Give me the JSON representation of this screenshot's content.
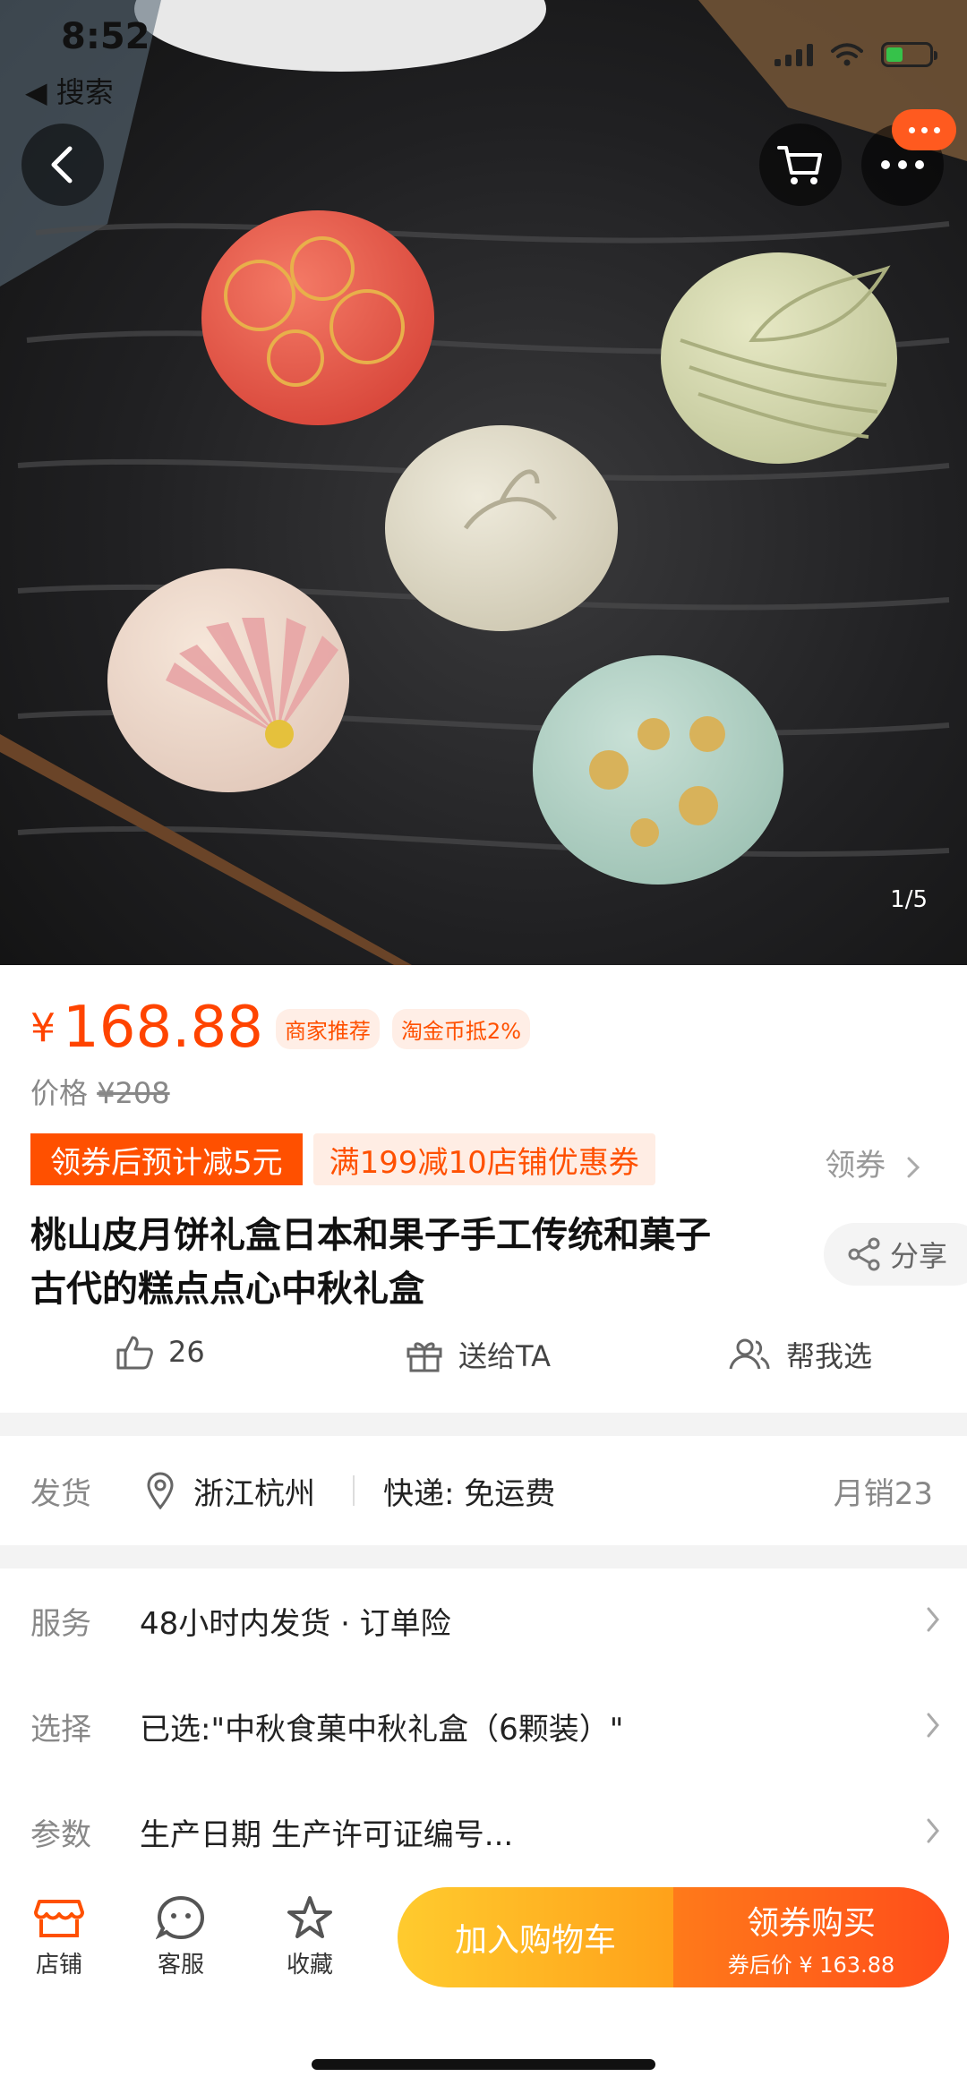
{
  "status_bar": {
    "time": "8:52",
    "back_label": "◀ 搜索"
  },
  "gallery": {
    "page_indicator": "1/5"
  },
  "price": {
    "currency": "¥",
    "value": "168.88",
    "tags": [
      "商家推荐",
      "淘金币抵2%"
    ],
    "original_label": "价格",
    "original_value": "¥208"
  },
  "coupons": {
    "primary": "领券后预计减5元",
    "secondary": "满199减10店铺优惠券",
    "get_label": "领券"
  },
  "product": {
    "title_line1": "桃山皮月饼礼盒日本和果子手工传统和菓子",
    "title_line2": "古代的糕点点心中秋礼盒",
    "share_label": "分享"
  },
  "actions": {
    "likes": "26",
    "gift_label": "送给TA",
    "help_label": "帮我选"
  },
  "shipping": {
    "label": "发货",
    "location": "浙江杭州",
    "express": "快递: 免运费",
    "sales": "月销23"
  },
  "details": [
    {
      "label": "服务",
      "value": "48小时内发货 · 订单险"
    },
    {
      "label": "选择",
      "value": "已选:\"中秋食菓中秋礼盒（6颗装）\""
    },
    {
      "label": "参数",
      "value": "生产日期 生产许可证编号..."
    }
  ],
  "bottom_bar": {
    "shop_label": "店铺",
    "service_label": "客服",
    "fav_label": "收藏",
    "cart_label": "加入购物车",
    "buy_label": "领券购买",
    "buy_sub": "券后价 ¥ 163.88"
  },
  "colors": {
    "accent": "#ff5000",
    "price": "#ff4400",
    "cart_gradient": "#ffb21f",
    "buy_gradient": "#ff5a1a"
  }
}
